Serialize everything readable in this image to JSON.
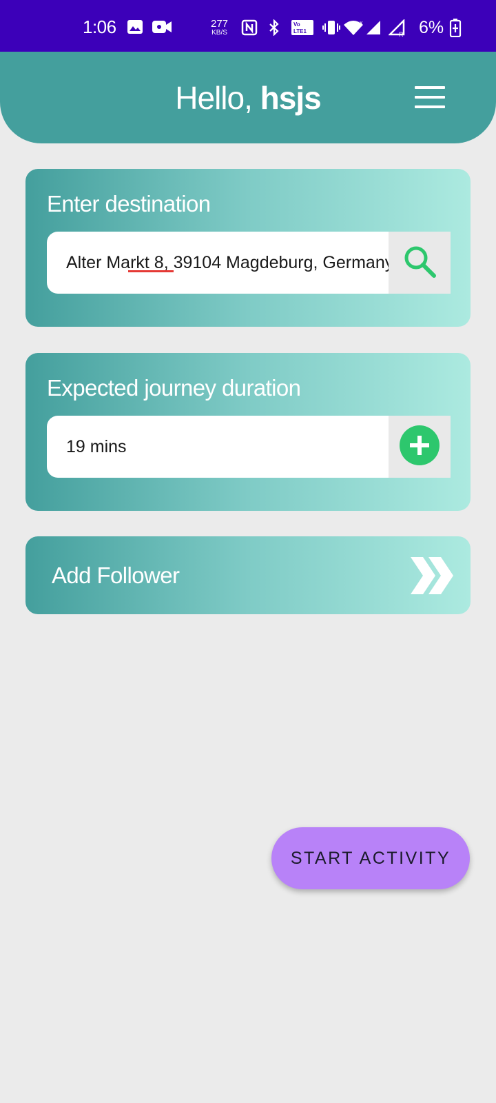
{
  "status_bar": {
    "time": "1:06",
    "net_speed_value": "277",
    "net_speed_unit": "KB/S",
    "battery_percent": "6%",
    "icons": [
      "image-icon",
      "video-camera-icon",
      "nfc-icon",
      "bluetooth-icon",
      "volte-icon",
      "vibrate-icon",
      "wifi-icon",
      "signal-icon",
      "signal-roaming-icon",
      "battery-charging-icon"
    ]
  },
  "header": {
    "greeting_prefix": "Hello,",
    "user_name": "hsjs",
    "menu_icon": "hamburger-menu-icon"
  },
  "destination": {
    "title": "Enter destination",
    "value": "Alter Markt 8, 39104 Magdeburg, Germany",
    "button_icon": "search-icon"
  },
  "duration": {
    "title": "Expected journey duration",
    "value": "19 mins",
    "button_icon": "plus-circle-icon"
  },
  "follower": {
    "label": "Add Follower",
    "icon": "double-chevron-right-icon"
  },
  "actions": {
    "start_label": "START ACTIVITY"
  },
  "colors": {
    "status_bar": "#3c00b9",
    "header": "#449f9d",
    "card_gradient_start": "#449f9d",
    "card_gradient_end": "#aceae0",
    "accent_green": "#2dc76d",
    "start_button": "#b882f8",
    "background": "#ebebeb"
  }
}
